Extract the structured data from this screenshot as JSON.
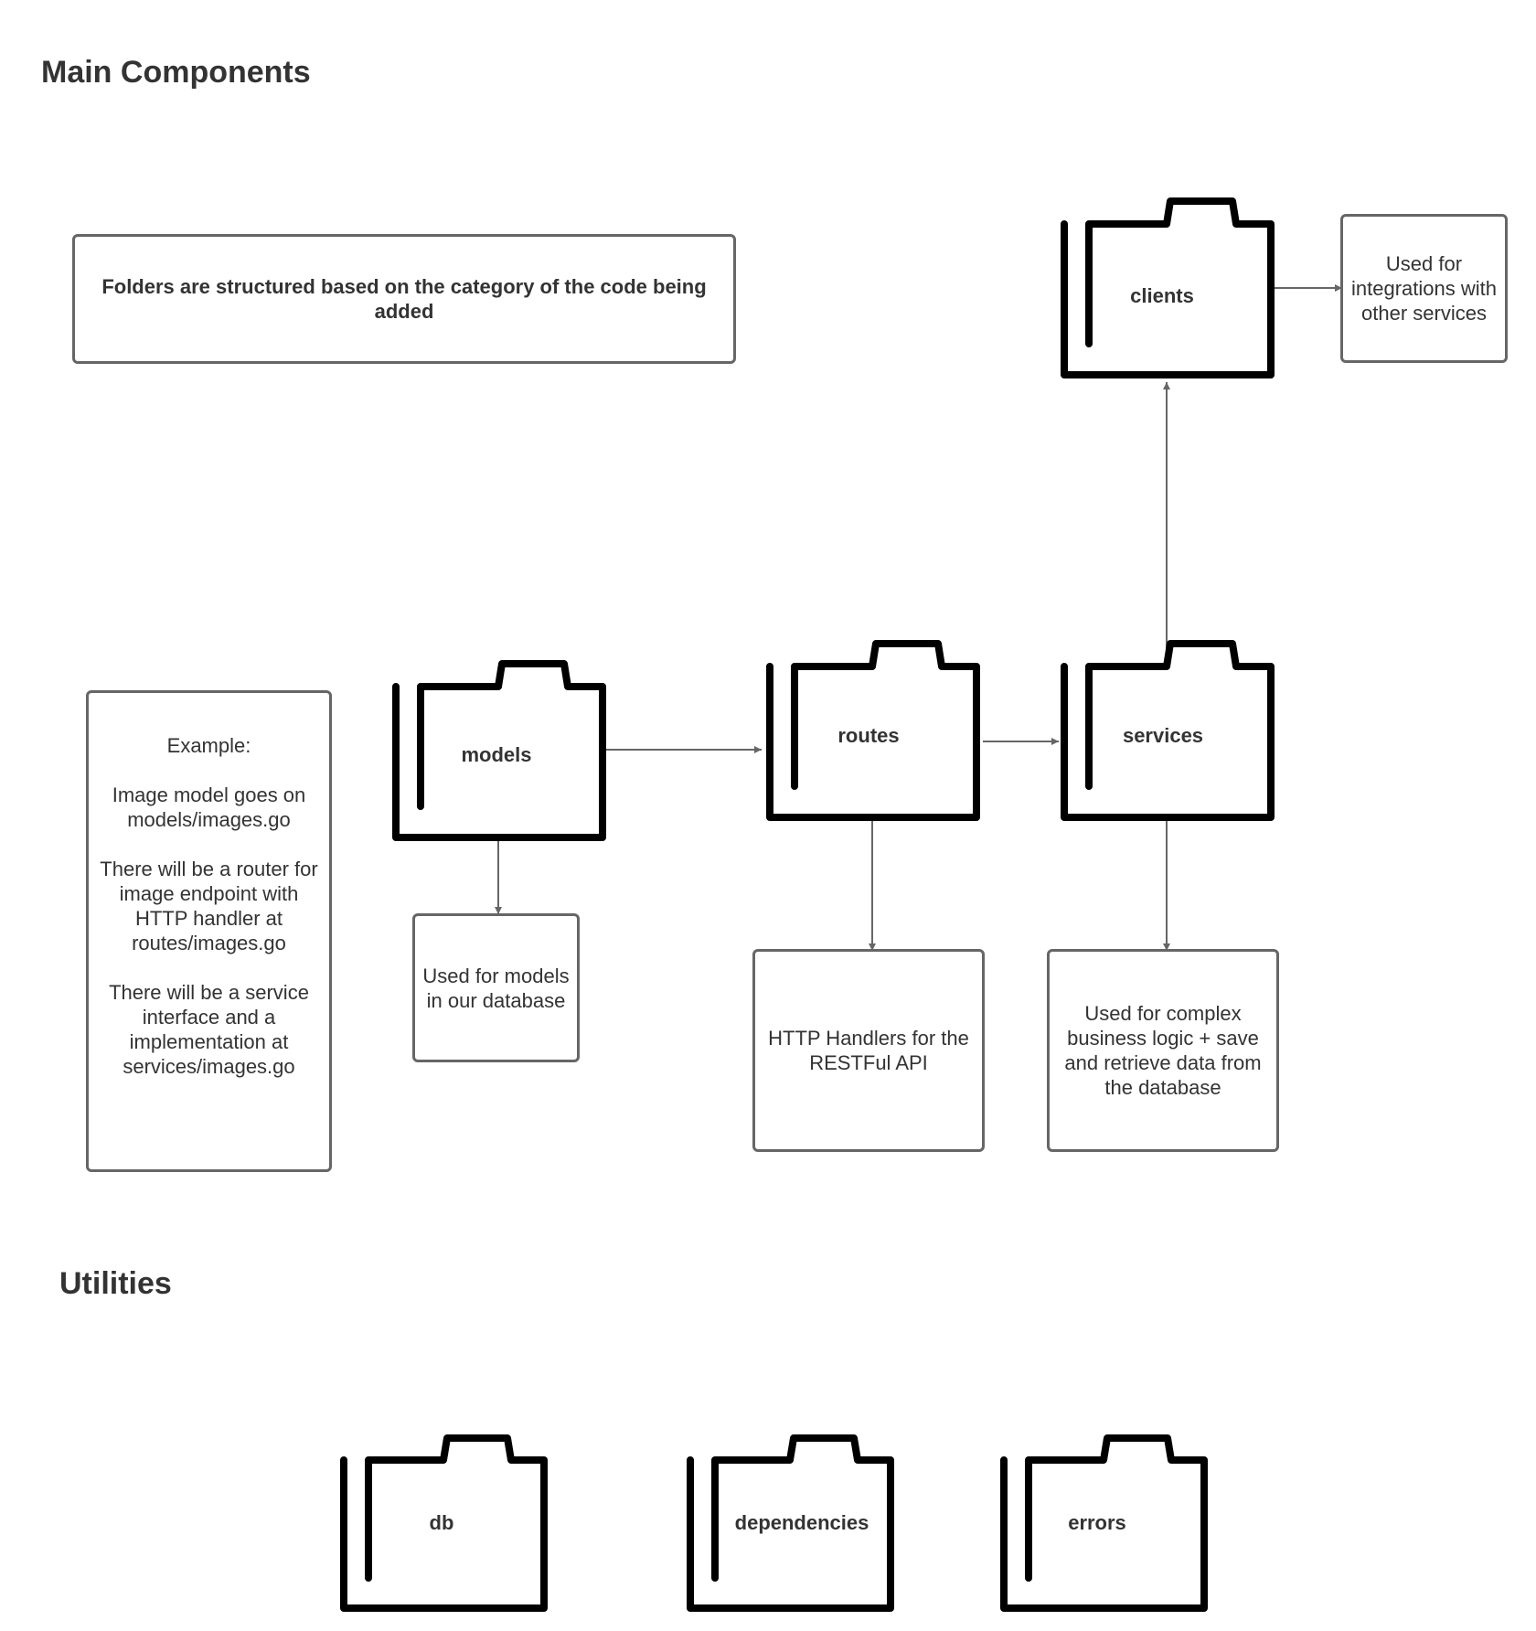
{
  "headings": {
    "main": "Main Components",
    "utilities": "Utilities"
  },
  "notes": {
    "structure": "Folders are structured based on the category of the code being added",
    "example": "Example:\n\nImage model goes on models/images.go\n\nThere will be a router for image endpoint with HTTP handler at routes/images.go\n\nThere will be a service interface and a implementation at services/images.go",
    "models_desc": "Used for models in our database",
    "routes_desc": "HTTP Handlers for the RESTFul API",
    "services_desc": "Used for complex business logic + save and retrieve data from the database",
    "clients_desc": "Used for integrations with other services"
  },
  "folders": {
    "clients": "clients",
    "models": "models",
    "routes": "routes",
    "services": "services",
    "db": "db",
    "dependencies": "dependencies",
    "errors": "errors"
  },
  "icons": {
    "folder": "folder-icon",
    "arrow": "arrow-icon"
  },
  "colors": {
    "folder_stroke": "#000000",
    "box_border": "#666666",
    "connector": "#666666",
    "text": "#333333"
  }
}
